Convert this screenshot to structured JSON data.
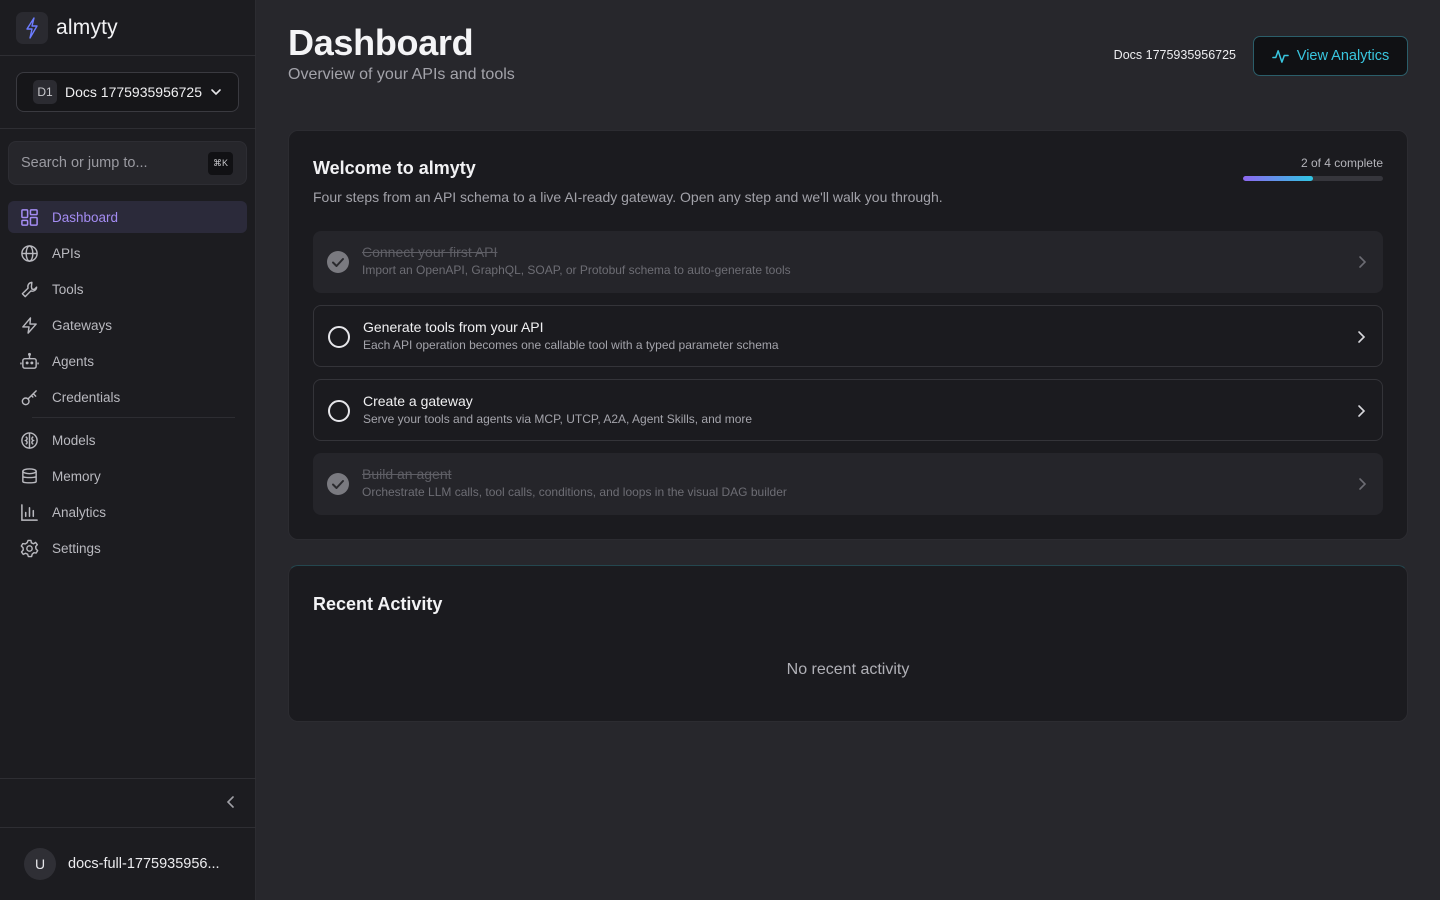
{
  "brand": {
    "name": "almyty"
  },
  "workspace": {
    "badge": "D1",
    "name": "Docs 1775935956725"
  },
  "search": {
    "placeholder": "Search or jump to...",
    "shortcut": "⌘K"
  },
  "nav": {
    "primary": [
      {
        "label": "Dashboard",
        "icon": "dashboard-icon",
        "active": true
      },
      {
        "label": "APIs",
        "icon": "globe-icon"
      },
      {
        "label": "Tools",
        "icon": "wrench-icon"
      },
      {
        "label": "Gateways",
        "icon": "lightning-icon"
      },
      {
        "label": "Agents",
        "icon": "robot-icon"
      },
      {
        "label": "Credentials",
        "icon": "key-icon"
      }
    ],
    "secondary": [
      {
        "label": "Models",
        "icon": "brain-icon"
      },
      {
        "label": "Memory",
        "icon": "database-icon"
      },
      {
        "label": "Analytics",
        "icon": "bar-chart-icon"
      },
      {
        "label": "Settings",
        "icon": "gear-icon"
      }
    ]
  },
  "user": {
    "initial": "U",
    "name": "docs-full-1775935956..."
  },
  "header": {
    "title": "Dashboard",
    "subtitle": "Overview of your APIs and tools",
    "workspace_label": "Docs 1775935956725",
    "analytics_button": "View Analytics"
  },
  "welcome": {
    "title": "Welcome to almyty",
    "subtitle": "Four steps from an API schema to a live AI-ready gateway. Open any step and we'll walk you through.",
    "progress_label": "2 of 4 complete",
    "progress_fraction": 0.5,
    "steps": [
      {
        "title": "Connect your first API",
        "description": "Import an OpenAPI, GraphQL, SOAP, or Protobuf schema to auto-generate tools",
        "done": true
      },
      {
        "title": "Generate tools from your API",
        "description": "Each API operation becomes one callable tool with a typed parameter schema",
        "done": false
      },
      {
        "title": "Create a gateway",
        "description": "Serve your tools and agents via MCP, UTCP, A2A, Agent Skills, and more",
        "done": false
      },
      {
        "title": "Build an agent",
        "description": "Orchestrate LLM calls, tool calls, conditions, and loops in the visual DAG builder",
        "done": true
      }
    ]
  },
  "activity": {
    "title": "Recent Activity",
    "empty": "No recent activity"
  },
  "colors": {
    "accent": "#a48cf2",
    "cyan": "#39c6df",
    "sidebar_bg": "#1c1c20",
    "page_bg": "#27272c"
  }
}
